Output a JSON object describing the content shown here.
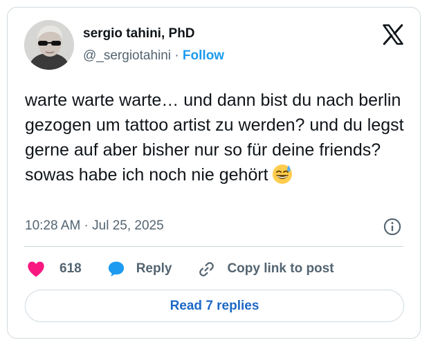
{
  "author": {
    "display_name": "sergio tahini, PhD",
    "handle": "@_sergiotahini",
    "separator": "·",
    "follow_label": "Follow"
  },
  "tweet": {
    "text": "warte warte warte… und dann bist du nach berlin gezogen um tattoo artist zu werden? und du legst gerne auf aber bisher nur so für deine friends? sowas habe ich noch nie gehört",
    "emoji": "😅",
    "timestamp": "10:28 AM · Jul 25, 2025"
  },
  "actions": {
    "like_count": "618",
    "reply_label": "Reply",
    "copy_link_label": "Copy link to post"
  },
  "read_replies_label": "Read 7 replies",
  "icons": {
    "logo": "x-logo-icon",
    "info": "info-icon",
    "like": "heart-icon",
    "reply": "reply-bubble-icon",
    "copy": "link-icon"
  },
  "colors": {
    "accent": "#1d9bf0",
    "link_text": "#1d68c6",
    "like": "#f91880",
    "secondary_text": "#536471",
    "border": "#cfd9de"
  }
}
